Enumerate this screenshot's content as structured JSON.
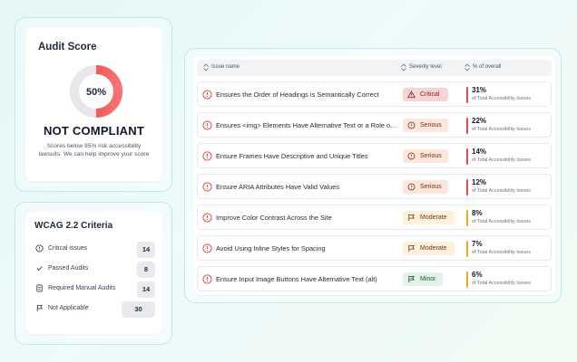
{
  "audit_score": {
    "title": "Audit Score",
    "percent": 50,
    "percent_label": "50%",
    "status": "NOT COMPLIANT",
    "note": "Scores below 95% risk accessibility lawsuits. We can help improve your score"
  },
  "wcag": {
    "title": "WCAG 2.2 Criteria",
    "rows": [
      {
        "icon": "alert-circle-icon",
        "label": "Critical issues",
        "count": "14"
      },
      {
        "icon": "check-icon",
        "label": "Passed Audits",
        "count": "8"
      },
      {
        "icon": "document-icon",
        "label": "Required Manual Audits",
        "count": "14"
      },
      {
        "icon": "flag-icon",
        "label": "Not Applicable",
        "count": "30"
      }
    ]
  },
  "issues": {
    "columns": {
      "name": "Issue name",
      "severity": "Severity level",
      "percent": "% of overall"
    },
    "percent_caption": "of Total Accessibility Issues",
    "rows": [
      {
        "name": "Ensures the Order of Headings is Semantically Correct",
        "severity": "Critical",
        "level": "critical",
        "percent": "31%"
      },
      {
        "name": "Ensures <img> Elements Have Alternative Text or a Role of None or Presentation",
        "severity": "Serious",
        "level": "serious",
        "percent": "22%"
      },
      {
        "name": "Ensure Frames Have Descriptive and Unique Titles",
        "severity": "Serious",
        "level": "serious",
        "percent": "14%"
      },
      {
        "name": "Ensure ARIA Attributes Have Valid Values",
        "severity": "Serious",
        "level": "serious",
        "percent": "12%"
      },
      {
        "name": "Improve Color Contrast Across the Site",
        "severity": "Moderate",
        "level": "moderate",
        "percent": "8%"
      },
      {
        "name": "Avoid Using Inline Styles for Spacing",
        "severity": "Moderate",
        "level": "moderate",
        "percent": "7%"
      },
      {
        "name": "Ensure Input Image Buttons Have Alternative Text (alt)",
        "severity": "Minor",
        "level": "minor",
        "percent": "6%"
      }
    ]
  },
  "colors": {
    "accent_red": "#ef4444",
    "donut_track": "#e5e7eb",
    "bar_red": "#e5484d",
    "bar_orange": "#f5a524"
  }
}
